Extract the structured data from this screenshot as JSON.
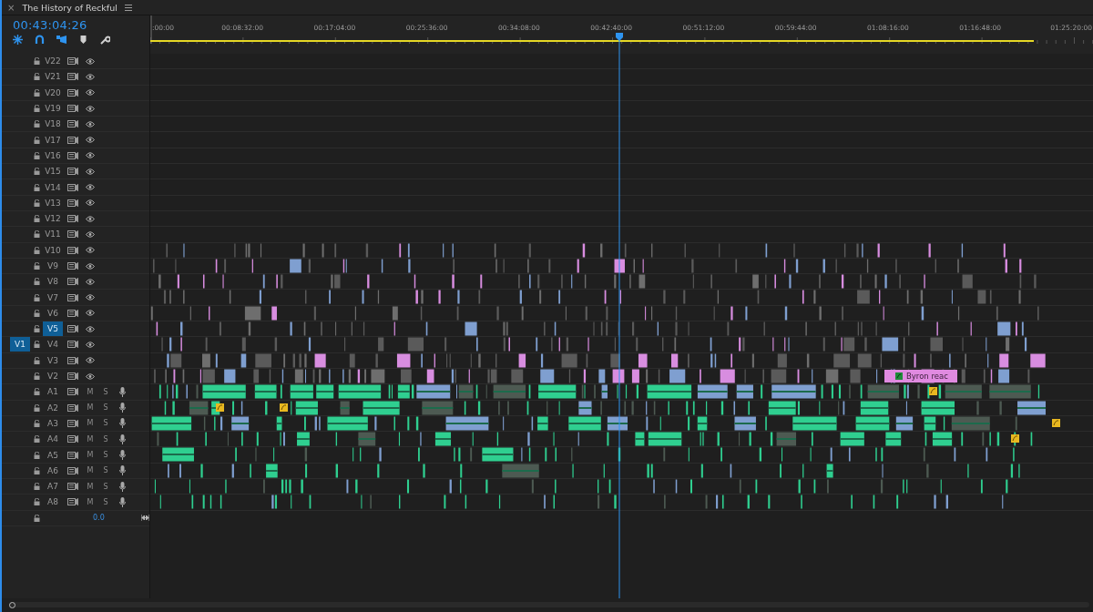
{
  "panel": {
    "title": "The History of Reckful",
    "close": "×"
  },
  "timecode": "00:43:04:26",
  "ruler": {
    "labels": [
      ":00:00",
      "00:08:32:00",
      "00:17:04:00",
      "00:25:36:00",
      "00:34:08:00",
      "00:42:40:00",
      "00:51:12:00",
      "00:59:44:00",
      "01:08:16:00",
      "01:16:48:00",
      "01:25:20:00"
    ]
  },
  "tracks": [
    {
      "label": "V22",
      "kind": "video",
      "selected": false
    },
    {
      "label": "V21",
      "kind": "video",
      "selected": false
    },
    {
      "label": "V20",
      "kind": "video",
      "selected": false
    },
    {
      "label": "V19",
      "kind": "video",
      "selected": false
    },
    {
      "label": "V18",
      "kind": "video",
      "selected": false
    },
    {
      "label": "V17",
      "kind": "video",
      "selected": false
    },
    {
      "label": "V16",
      "kind": "video",
      "selected": false
    },
    {
      "label": "V15",
      "kind": "video",
      "selected": false
    },
    {
      "label": "V14",
      "kind": "video",
      "selected": false
    },
    {
      "label": "V13",
      "kind": "video",
      "selected": false
    },
    {
      "label": "V12",
      "kind": "video",
      "selected": false
    },
    {
      "label": "V11",
      "kind": "video",
      "selected": false
    },
    {
      "label": "V10",
      "kind": "video",
      "selected": false
    },
    {
      "label": "V9",
      "kind": "video",
      "selected": false
    },
    {
      "label": "V8",
      "kind": "video",
      "selected": false
    },
    {
      "label": "V7",
      "kind": "video",
      "selected": false
    },
    {
      "label": "V6",
      "kind": "video",
      "selected": false
    },
    {
      "label": "V5",
      "kind": "video",
      "selected": true
    },
    {
      "label": "V4",
      "kind": "video",
      "selected": false,
      "source_patch": "V1"
    },
    {
      "label": "V3",
      "kind": "video",
      "selected": false
    },
    {
      "label": "V2",
      "kind": "video",
      "selected": false,
      "clip_label": "Byron reac"
    },
    {
      "label": "A1",
      "kind": "audio",
      "selected": false,
      "mute": "M",
      "solo": "S"
    },
    {
      "label": "A2",
      "kind": "audio",
      "selected": false,
      "mute": "M",
      "solo": "S"
    },
    {
      "label": "A3",
      "kind": "audio",
      "selected": false,
      "mute": "M",
      "solo": "S"
    },
    {
      "label": "A4",
      "kind": "audio",
      "selected": false,
      "mute": "M",
      "solo": "S"
    },
    {
      "label": "A5",
      "kind": "audio",
      "selected": false,
      "mute": "M",
      "solo": "S"
    },
    {
      "label": "A6",
      "kind": "audio",
      "selected": false,
      "mute": "M",
      "solo": "S"
    },
    {
      "label": "A7",
      "kind": "audio",
      "selected": false,
      "mute": "M",
      "solo": "S"
    },
    {
      "label": "A8",
      "kind": "audio",
      "selected": false,
      "mute": "M",
      "solo": "S"
    }
  ],
  "master": {
    "reading": "0.0"
  }
}
